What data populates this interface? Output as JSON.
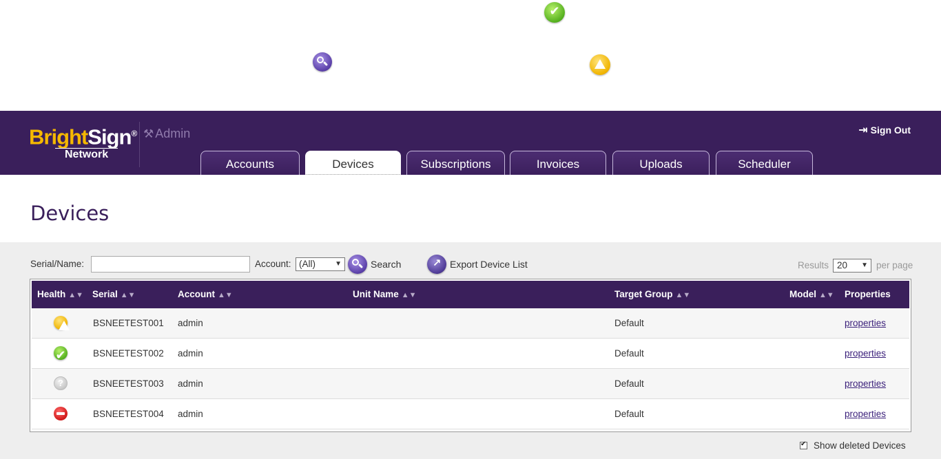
{
  "brand": {
    "logo_bright": "Bright",
    "logo_sign": "Sign",
    "logo_mark": "®",
    "logo_sub": "Network",
    "admin_label": "Admin"
  },
  "header": {
    "sign_out": "Sign Out",
    "tabs": [
      {
        "label": "Accounts",
        "active": false
      },
      {
        "label": "Devices",
        "active": true
      },
      {
        "label": "Subscriptions",
        "active": false
      },
      {
        "label": "Invoices",
        "active": false
      },
      {
        "label": "Uploads",
        "active": false
      },
      {
        "label": "Scheduler",
        "active": false
      }
    ]
  },
  "page": {
    "title": "Devices"
  },
  "filters": {
    "serial_label": "Serial/Name:",
    "serial_value": "",
    "account_label": "Account:",
    "account_value": "(All)",
    "search_label": "Search",
    "export_label": "Export Device List",
    "results_label": "Results",
    "results_value": "20",
    "per_page_label": "per page"
  },
  "table": {
    "columns": [
      "Health",
      "Serial",
      "Account",
      "Unit Name",
      "Target Group",
      "Model",
      "Properties"
    ],
    "rows": [
      {
        "health": "warning",
        "serial": "BSNEETEST001",
        "account": "admin",
        "unit_name": "",
        "target_group": "Default",
        "model": "",
        "properties": "properties"
      },
      {
        "health": "ok",
        "serial": "BSNEETEST002",
        "account": "admin",
        "unit_name": "",
        "target_group": "Default",
        "model": "",
        "properties": "properties"
      },
      {
        "health": "unknown",
        "serial": "BSNEETEST003",
        "account": "admin",
        "unit_name": "",
        "target_group": "Default",
        "model": "",
        "properties": "properties"
      },
      {
        "health": "error",
        "serial": "BSNEETEST004",
        "account": "admin",
        "unit_name": "",
        "target_group": "Default",
        "model": "",
        "properties": "properties"
      }
    ]
  },
  "footer": {
    "show_deleted_label": "Show deleted Devices",
    "show_deleted_checked": true
  },
  "colors": {
    "brand_purple": "#3a1f5b",
    "brand_yellow": "#f5b800",
    "link": "#3a1f7a"
  }
}
